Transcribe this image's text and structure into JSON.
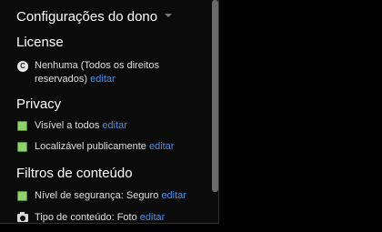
{
  "title": "Configurações do dono",
  "edit_label": "editar",
  "license": {
    "heading": "License",
    "value": "Nenhuma (Todos os direitos reservados)",
    "edit": "editar",
    "icon": "copyright-icon"
  },
  "privacy": {
    "heading": "Privacy",
    "items": [
      {
        "label": "Visível a todos",
        "edit": "editar",
        "icon": "green-check-icon"
      },
      {
        "label": "Localizável publicamente",
        "edit": "editar",
        "icon": "green-check-icon"
      }
    ]
  },
  "filters": {
    "heading": "Filtros de conteúdo",
    "items": [
      {
        "label": "Nível de segurança: Seguro",
        "edit": "editar",
        "icon": "green-check-icon"
      },
      {
        "label": "Tipo de conteúdo: Foto",
        "edit": "editar",
        "icon": "camera-icon"
      }
    ]
  },
  "colors": {
    "background": "#000000",
    "panel": "#0b0b0b",
    "link": "#4d8fe0",
    "check": "#8ed26a"
  }
}
